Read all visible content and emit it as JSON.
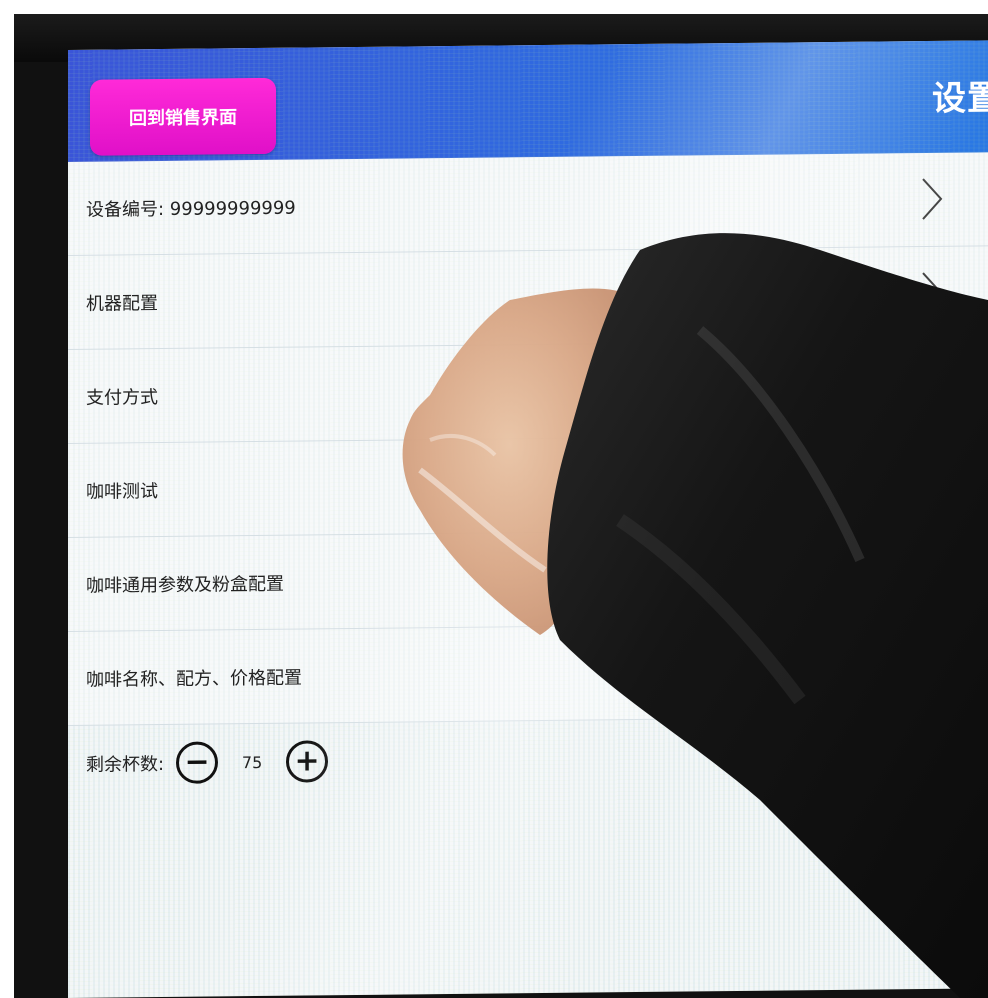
{
  "header": {
    "back_button_label": "回到销售界面",
    "title": "设置"
  },
  "menu": {
    "items": [
      {
        "label": "设备编号: 99999999999"
      },
      {
        "label": "机器配置"
      },
      {
        "label": "支付方式"
      },
      {
        "label": "咖啡测试"
      },
      {
        "label": "咖啡通用参数及粉盒配置"
      },
      {
        "label": "咖啡名称、配方、价格配置"
      }
    ]
  },
  "cups": {
    "label": "剩余杯数:",
    "minus_symbol": "−",
    "value": "75",
    "plus_symbol": "+"
  },
  "colors": {
    "header_blue": "#2f6ae0",
    "back_button_magenta": "#e81bd0",
    "screen_background": "#f3f6f7"
  },
  "icons": [
    "chevron-right-icon",
    "minus-circle-icon",
    "plus-circle-icon"
  ]
}
